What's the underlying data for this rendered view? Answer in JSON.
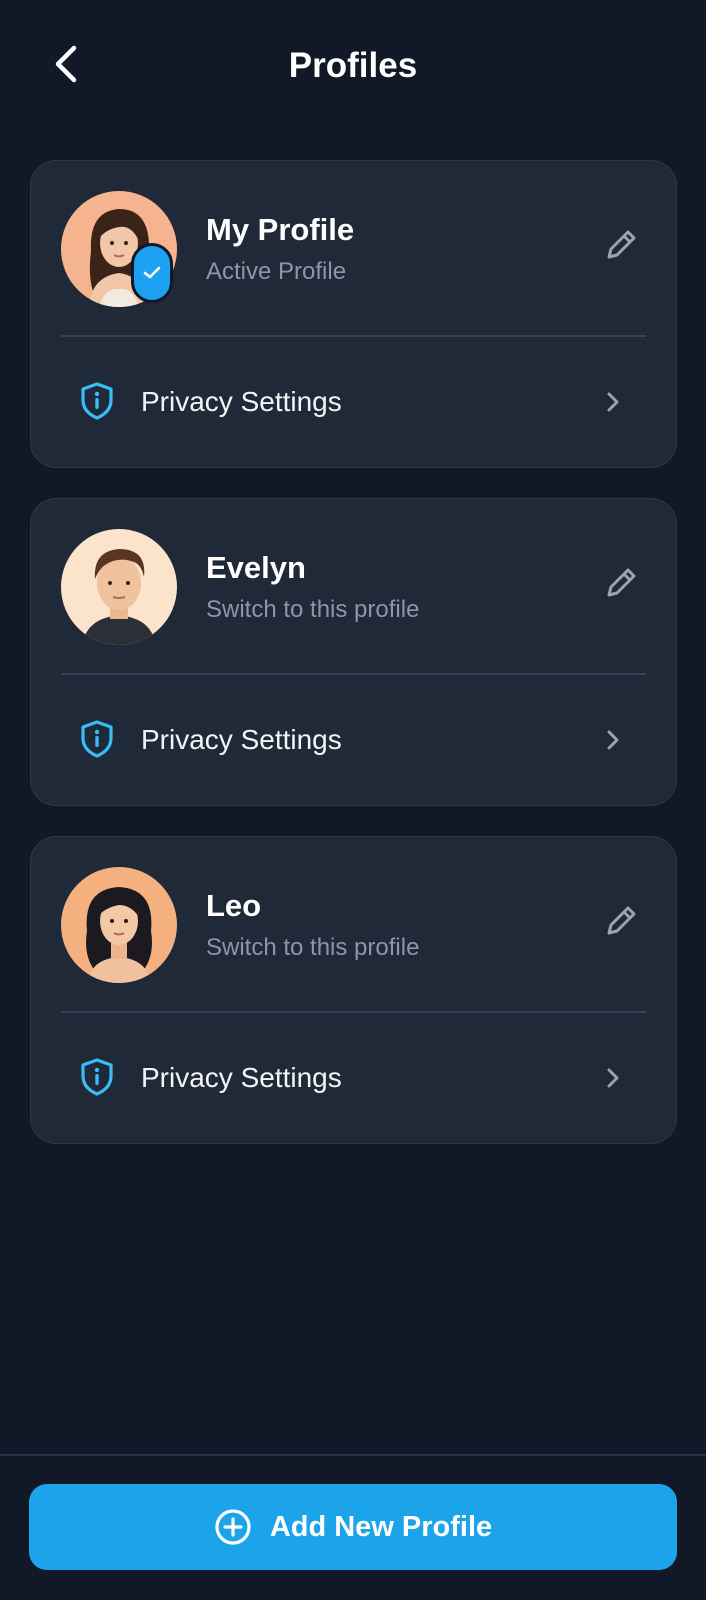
{
  "header": {
    "title": "Profiles",
    "back_icon": "chevron-left-icon"
  },
  "profiles": [
    {
      "name": "My Profile",
      "subtitle": "Active Profile",
      "active": true,
      "privacy_label": "Privacy Settings"
    },
    {
      "name": "Evelyn",
      "subtitle": "Switch to this profile",
      "active": false,
      "privacy_label": "Privacy Settings"
    },
    {
      "name": "Leo",
      "subtitle": "Switch to this profile",
      "active": false,
      "privacy_label": "Privacy Settings"
    }
  ],
  "footer": {
    "add_label": "Add New Profile"
  },
  "colors": {
    "background": "#111827",
    "card": "#1f2937",
    "accent": "#1ba4ea",
    "muted_text": "#8b96a8"
  }
}
